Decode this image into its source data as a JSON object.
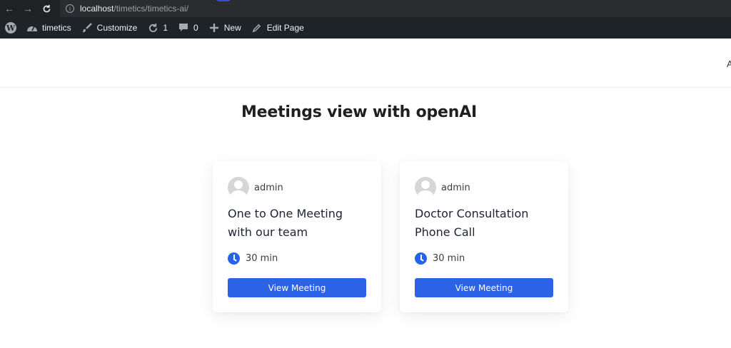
{
  "browser": {
    "url_host": "localhost",
    "url_path": "/timetics/timetics-ai/"
  },
  "admin_bar": {
    "site_name": "timetics",
    "customize": "Customize",
    "updates_count": "1",
    "comments_count": "0",
    "new_label": "New",
    "edit_page": "Edit Page"
  },
  "header": {
    "cut_text": "A"
  },
  "page": {
    "title": "Meetings view with openAI"
  },
  "meetings": [
    {
      "author": "admin",
      "title": "One to One Meeting with our team",
      "duration": "30 min",
      "button": "View Meeting"
    },
    {
      "author": "admin",
      "title": "Doctor Consultation Phone Call",
      "duration": "30 min",
      "button": "View Meeting"
    }
  ],
  "colors": {
    "accent": "#2c62e6",
    "admin_bar": "#1d2327",
    "browser_bar": "#202124"
  }
}
